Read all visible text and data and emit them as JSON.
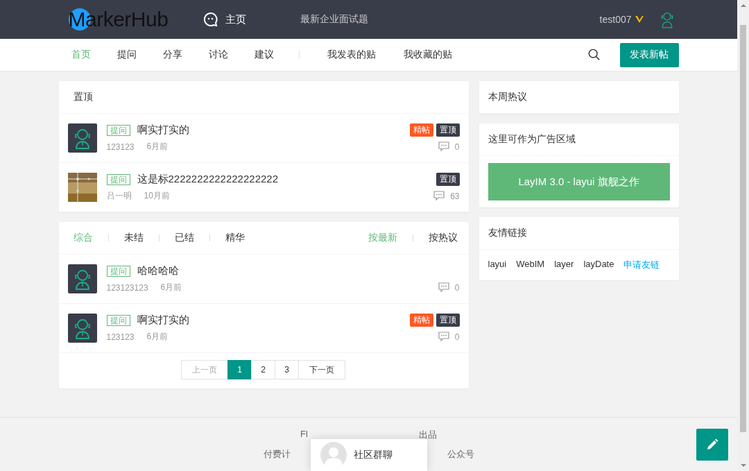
{
  "header": {
    "logo": "MarkerHub",
    "nav": [
      {
        "label": "主页",
        "kind": "icon"
      },
      {
        "label": "最新企业面试题",
        "kind": "plain"
      }
    ],
    "user": {
      "name": "test007"
    }
  },
  "subnav": {
    "left": [
      {
        "label": "首页",
        "selected": true
      },
      {
        "label": "提问",
        "selected": false
      },
      {
        "label": "分享",
        "selected": false
      },
      {
        "label": "讨论",
        "selected": false
      },
      {
        "label": "建议",
        "selected": false
      }
    ],
    "right": [
      {
        "label": "我发表的贴",
        "selected": false
      },
      {
        "label": "我收藏的贴",
        "selected": false
      }
    ],
    "post_button": "发表新帖"
  },
  "pinned": {
    "title": "置顶",
    "posts": [
      {
        "kind": "icon",
        "tag": "提问",
        "title": "啊实打实的",
        "author": "123123",
        "time": "6月前",
        "badges": [
          {
            "label": "精帖",
            "kind": "featured"
          },
          {
            "label": "置顶",
            "kind": "top"
          }
        ],
        "comments": "0"
      },
      {
        "kind": "picture",
        "tag": "提问",
        "title": "这是标2222222222222222222",
        "author": "吕一明",
        "time": "10月前",
        "badges": [
          {
            "label": "置顶",
            "kind": "top"
          }
        ],
        "comments": "63"
      }
    ]
  },
  "list": {
    "filters": [
      {
        "label": "综合",
        "selected": true
      },
      {
        "label": "未结",
        "selected": false
      },
      {
        "label": "已结",
        "selected": false
      },
      {
        "label": "精华",
        "selected": false
      }
    ],
    "sorts": [
      {
        "label": "按最新",
        "selected": true
      },
      {
        "label": "按热议",
        "selected": false
      }
    ],
    "posts": [
      {
        "kind": "icon",
        "tag": "提问",
        "title": "哈哈哈哈",
        "author": "123123123",
        "time": "6月前",
        "comments": "0"
      },
      {
        "kind": "icon",
        "tag": "提问",
        "title": "啊实打实的",
        "author": "123123",
        "time": "6月前",
        "badges": [
          {
            "label": "精帖",
            "kind": "featured"
          },
          {
            "label": "置顶",
            "kind": "top"
          }
        ],
        "comments": "0"
      }
    ],
    "pagination": {
      "prev": "上一页",
      "prev_disabled": true,
      "pages": [
        {
          "label": "1",
          "selected": true
        },
        {
          "label": "2",
          "selected": false
        },
        {
          "label": "3",
          "selected": false
        }
      ],
      "next": "下一页"
    }
  },
  "sidebar": {
    "hot_title": "本周热议",
    "ad_title": "这里可作为广告区域",
    "ad_banner": "LayIM 3.0 - layui 旗舰之作",
    "links_title": "友情链接",
    "links": [
      {
        "label": "layui",
        "kind": "plain"
      },
      {
        "label": "WebIM",
        "kind": "plain"
      },
      {
        "label": "layer",
        "kind": "plain"
      },
      {
        "label": "layDate",
        "kind": "plain"
      },
      {
        "label": "申请友链",
        "kind": "apply"
      }
    ]
  },
  "footer": {
    "lines": [
      [
        "Fl",
        "出品"
      ],
      [
        "付费计",
        "公众号"
      ]
    ]
  },
  "chat_popup": {
    "label": "社区群聊"
  }
}
